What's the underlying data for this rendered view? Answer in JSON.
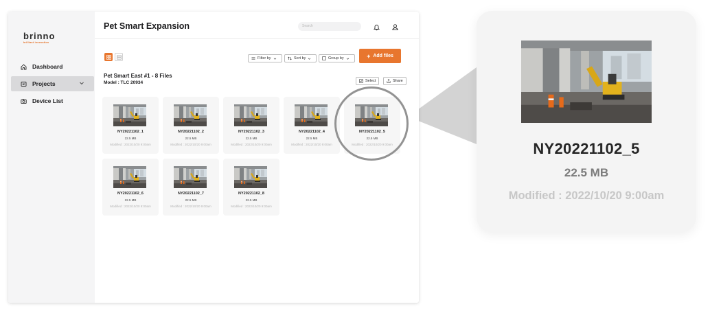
{
  "app": {
    "logo_word": "brinno",
    "logo_tagline": "brilliant innovation",
    "title": "Pet Smart Expansion",
    "search_placeholder": "Search"
  },
  "sidebar": {
    "items": [
      {
        "label": "Dashboard",
        "icon": "home-icon"
      },
      {
        "label": "Projects",
        "icon": "folder-icon",
        "active": true
      },
      {
        "label": "Device List",
        "icon": "camera-icon"
      }
    ]
  },
  "toolbar": {
    "filter_label": "Filter by",
    "sort_label": "Sort by",
    "group_label": "Group by",
    "add_label": "Add files"
  },
  "project": {
    "title": "Pet Smart East #1 - 8 Files",
    "model": "Model : TLC 20934",
    "select_label": "Select",
    "share_label": "Share"
  },
  "files": [
    {
      "name": "NY20221102_1",
      "size": "22.5 MB",
      "modified": "Modified : 2022/10/20 9:00am"
    },
    {
      "name": "NY20221102_2",
      "size": "22.5 MB",
      "modified": "Modified : 2022/10/20 9:00am"
    },
    {
      "name": "NY20221102_3",
      "size": "22.5 MB",
      "modified": "Modified : 2022/10/20 9:00am"
    },
    {
      "name": "NY20221102_4",
      "size": "22.5 MB",
      "modified": "Modified : 2022/10/20 9:00am"
    },
    {
      "name": "NY20221102_5",
      "size": "22.5 MB",
      "modified": "Modified : 2022/10/20 9:00am"
    },
    {
      "name": "NY20221102_6",
      "size": "22.5 MB",
      "modified": "Modified : 2022/10/20 9:00am"
    },
    {
      "name": "NY20221102_7",
      "size": "22.5 MB",
      "modified": "Modified : 2022/10/20 9:00am"
    },
    {
      "name": "NY20221102_8",
      "size": "22.5 MB",
      "modified": "Modified : 2022/10/20 9:00am"
    }
  ],
  "zoom": {
    "name": "NY20221102_5",
    "size": "22.5 MB",
    "modified": "Modified : 2022/10/20 9:00am"
  },
  "colors": {
    "accent": "#e8762e",
    "sidebar_bg": "#f5f5f6",
    "sidebar_active": "#d9d9db"
  }
}
